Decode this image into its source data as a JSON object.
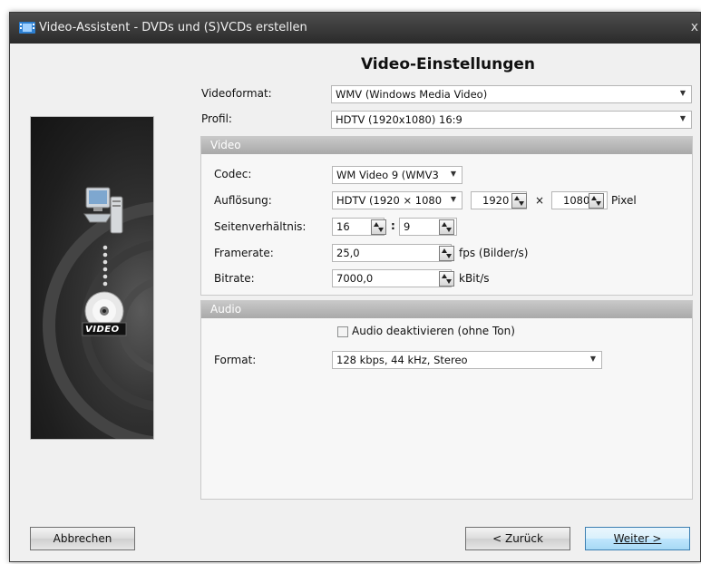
{
  "window": {
    "title": "Video-Assistent - DVDs und (S)VCDs erstellen",
    "close": "x"
  },
  "heading": "Video-Einstellungen",
  "main": {
    "videoformat_label": "Videoformat:",
    "videoformat_value": "WMV (Windows Media Video)",
    "profil_label": "Profil:",
    "profil_value": "HDTV (1920x1080) 16:9"
  },
  "video": {
    "title": "Video",
    "codec_label": "Codec:",
    "codec_value": "WM Video 9 (WMV3",
    "aufloesung_label": "Auflösung:",
    "aufloesung_value": "HDTV (1920 × 1080",
    "width": "1920",
    "times": "×",
    "height": "1080",
    "pixel_unit": "Pixel",
    "seiten_label": "Seitenverhältnis:",
    "aspect_w": "16",
    "aspect_sep": ":",
    "aspect_h": "9",
    "framerate_label": "Framerate:",
    "framerate_value": "25,0",
    "framerate_unit": "fps (Bilder/s)",
    "bitrate_label": "Bitrate:",
    "bitrate_value": "7000,0",
    "bitrate_unit": "kBit/s"
  },
  "audio": {
    "title": "Audio",
    "disable_label": "Audio deaktivieren (ohne Ton)",
    "disable_checked": false,
    "format_label": "Format:",
    "format_value": "128 kbps, 44 kHz, Stereo"
  },
  "sidebar": {
    "video_badge": "VIDEO"
  },
  "buttons": {
    "cancel": "Abbrechen",
    "back": "< Zurück",
    "next": "Weiter >"
  },
  "icons": {
    "title": "video-strip-icon",
    "computer": "computer-icon",
    "disc": "video-disc-icon",
    "spin": "spin-arrows-icon",
    "dropdown": "dropdown-arrow-icon"
  }
}
